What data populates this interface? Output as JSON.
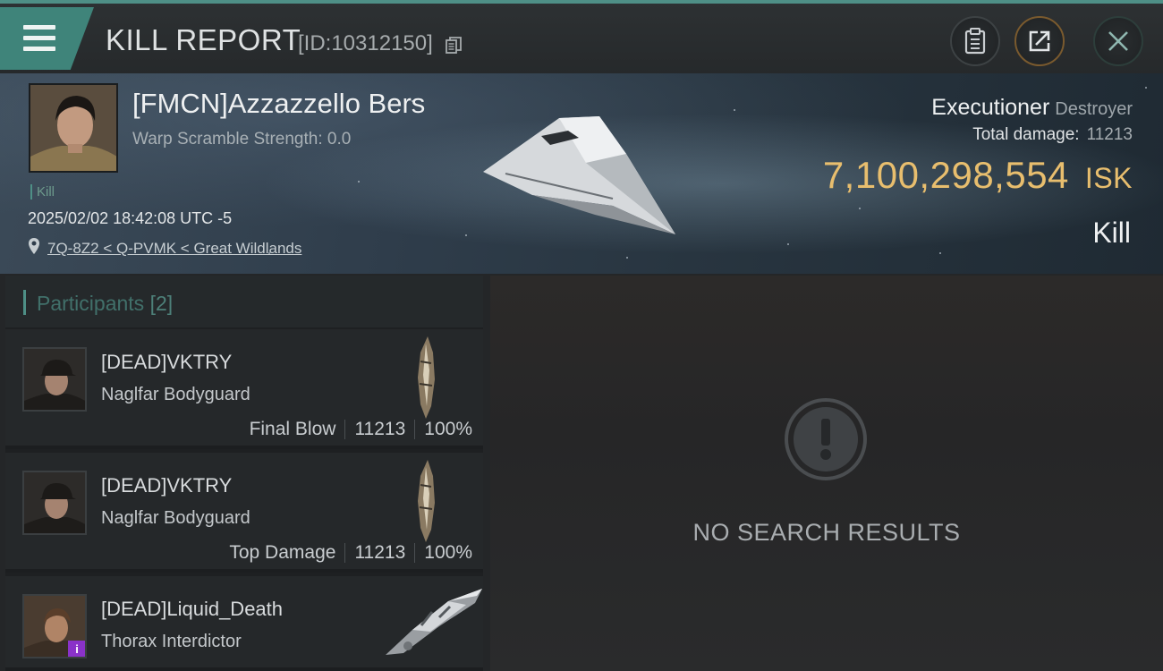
{
  "header": {
    "title": "KILL REPORT",
    "report_id": "[ID:10312150]",
    "icons": {
      "menu": "hamburger-menu-icon",
      "copy": "copy-icon",
      "clipboard": "clipboard-icon",
      "share": "share-icon",
      "close": "close-icon"
    }
  },
  "victim": {
    "name": "[FMCN]Azzazzello Bers",
    "warp_scramble": "Warp Scramble Strength: 0.0",
    "tag": "Kill",
    "datetime": "2025/02/02 18:42:08 UTC -5",
    "location": "7Q-8Z2 < Q-PVMK < Great Wildlands",
    "ship_name": "Executioner",
    "ship_class": "Destroyer",
    "total_damage_label": "Total damage:",
    "total_damage": "11213",
    "isk_value": "7,100,298,554",
    "isk_unit": "ISK",
    "result": "Kill"
  },
  "participants": {
    "title": "Participants",
    "count": "[2]",
    "rows": [
      {
        "name": "[DEAD]VKTRY",
        "ship": "Naglfar Bodyguard",
        "role": "Final Blow",
        "damage": "11213",
        "percent": "100%"
      },
      {
        "name": "[DEAD]VKTRY",
        "ship": "Naglfar Bodyguard",
        "role": "Top Damage",
        "damage": "11213",
        "percent": "100%"
      },
      {
        "name": "[DEAD]Liquid_Death",
        "ship": "Thorax Interdictor",
        "badge": "i"
      }
    ]
  },
  "results": {
    "empty_message": "NO SEARCH RESULTS",
    "icon": "exclamation-circle-icon"
  },
  "colors": {
    "accent_teal": "#4e8f86",
    "isk_gold": "#e8be6e",
    "badge_purple": "#8a32c9"
  }
}
